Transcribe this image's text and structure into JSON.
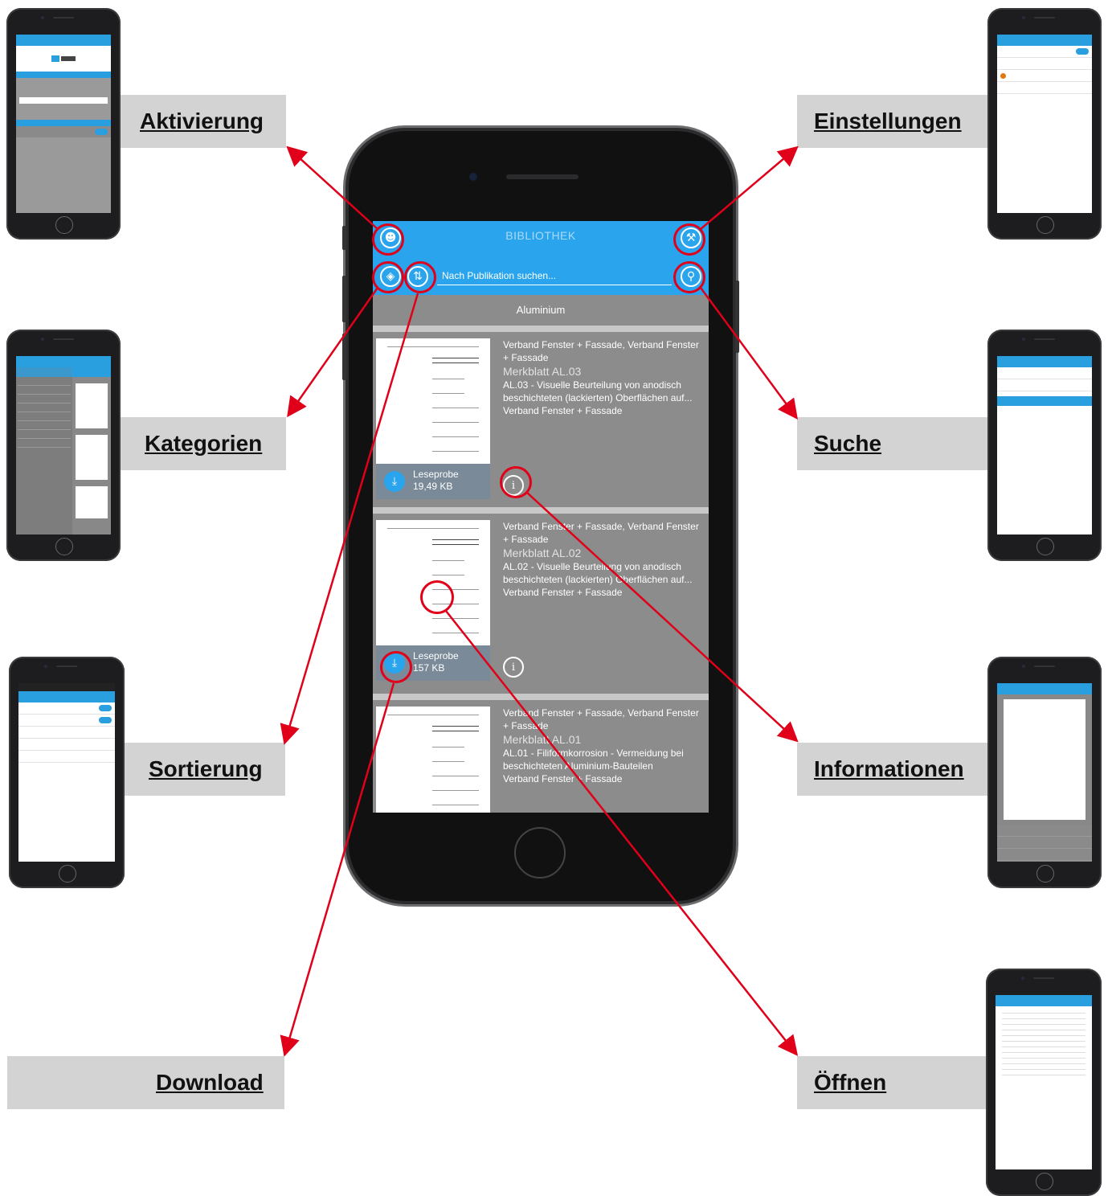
{
  "labels": {
    "aktivierung": "Aktivierung",
    "einstellungen": "Einstellungen",
    "kategorien": "Kategorien",
    "suche": "Suche",
    "sortierung": "Sortierung",
    "informationen": "Informationen",
    "download": "Download",
    "oeffnen": "Öffnen"
  },
  "app": {
    "title": "BIBLIOTHEK",
    "search_placeholder": "Nach Publikation suchen...",
    "category": "Aluminium"
  },
  "items": [
    {
      "publisher": "Verband Fenster + Fassade, Verband Fenster + Fassade",
      "code": "Merkblatt AL.03",
      "title": "AL.03 - Visuelle Beurteilung von anodisch beschichteten (lackierten) Oberflächen auf...",
      "author": "Verband Fenster + Fassade",
      "download_label": "Leseprobe",
      "size": "19,49 KB"
    },
    {
      "publisher": "Verband Fenster + Fassade, Verband Fenster + Fassade",
      "code": "Merkblatt AL.02",
      "title": "AL.02 - Visuelle Beurteilung von anodisch beschichteten (lackierten) Oberflächen auf...",
      "author": "Verband Fenster + Fassade",
      "download_label": "Leseprobe",
      "size": "157 KB"
    },
    {
      "publisher": "Verband Fenster + Fassade, Verband Fenster + Fassade",
      "code": "Merkblatt AL.01",
      "title": "AL.01 - Filiformkorrosion - Vermeidung bei beschichteten Aluminium-Bauteilen",
      "author": "Verband Fenster + Fassade"
    }
  ],
  "icons": {
    "profile": "person-icon",
    "settings": "wrench-icon",
    "categories": "tag-icon",
    "sort": "sort-arrows-icon",
    "search": "magnifier-icon",
    "download": "download-icon",
    "info": "info-icon"
  },
  "colors": {
    "accent": "#2aa4ec",
    "highlight": "#e0001a",
    "label_bg": "#d3d3d3"
  }
}
